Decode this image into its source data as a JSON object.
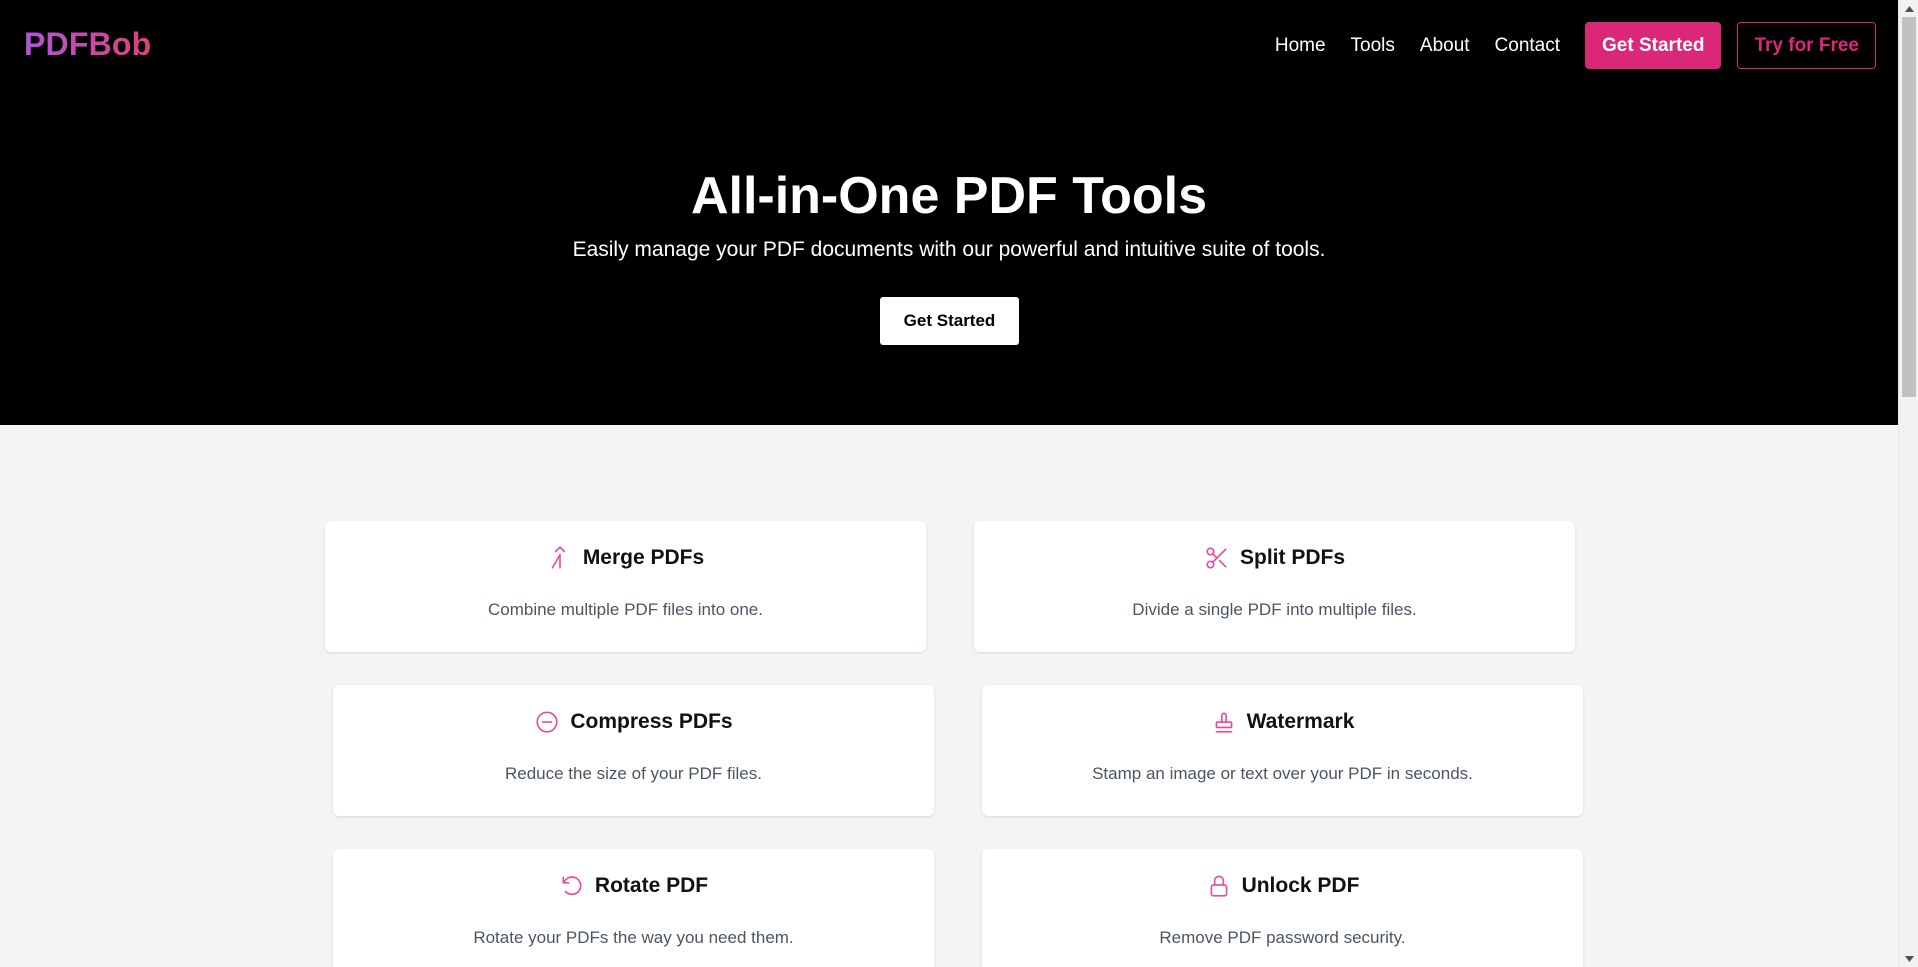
{
  "brand": {
    "logo": "PDFBob"
  },
  "nav": {
    "links": [
      "Home",
      "Tools",
      "About",
      "Contact"
    ],
    "get_started": "Get Started",
    "try_free": "Try for Free"
  },
  "hero": {
    "title": "All-in-One PDF Tools",
    "subtitle": "Easily manage your PDF documents with our powerful and intuitive suite of tools.",
    "cta": "Get Started"
  },
  "tools": [
    {
      "title": "Merge PDFs",
      "desc": "Combine multiple PDF files into one.",
      "icon": "merge-icon"
    },
    {
      "title": "Split PDFs",
      "desc": "Divide a single PDF into multiple files.",
      "icon": "scissors-icon"
    },
    {
      "title": "Compress PDFs",
      "desc": "Reduce the size of your PDF files.",
      "icon": "minus-circle-icon"
    },
    {
      "title": "Watermark",
      "desc": "Stamp an image or text over your PDF in seconds.",
      "icon": "stamp-icon"
    },
    {
      "title": "Rotate PDF",
      "desc": "Rotate your PDFs the way you need them.",
      "icon": "rotate-icon"
    },
    {
      "title": "Unlock PDF",
      "desc": "Remove PDF password security.",
      "icon": "lock-icon"
    }
  ],
  "colors": {
    "accent": "#db2777",
    "header_bg": "#000000",
    "page_bg": "#f3f4f6"
  }
}
